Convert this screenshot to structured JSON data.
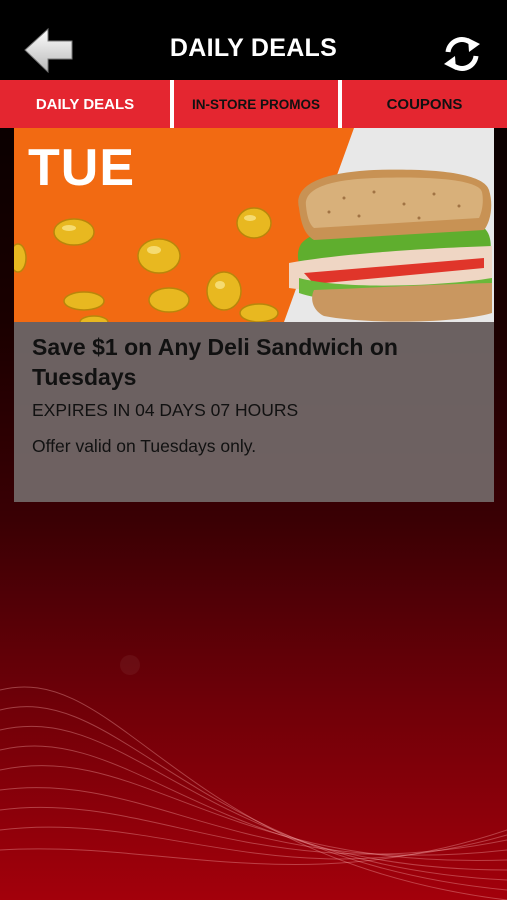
{
  "header": {
    "title": "DAILY DEALS",
    "back_icon": "back-arrow-icon",
    "refresh_icon": "refresh-icon"
  },
  "tabs": [
    {
      "label": "DAILY DEALS",
      "active": true
    },
    {
      "label": "IN-STORE PROMOS",
      "active": false
    },
    {
      "label": "COUPONS",
      "active": false
    }
  ],
  "deal": {
    "day": "TUE",
    "title": "Save $1 on Any Deli Sandwich on Tuesdays",
    "expires": "EXPIRES IN 04 DAYS 07 HOURS",
    "description": "Offer valid on Tuesdays only."
  },
  "colors": {
    "accent": "#e42630",
    "banner_orange": "#f26a12",
    "coin": "#e8b820"
  }
}
